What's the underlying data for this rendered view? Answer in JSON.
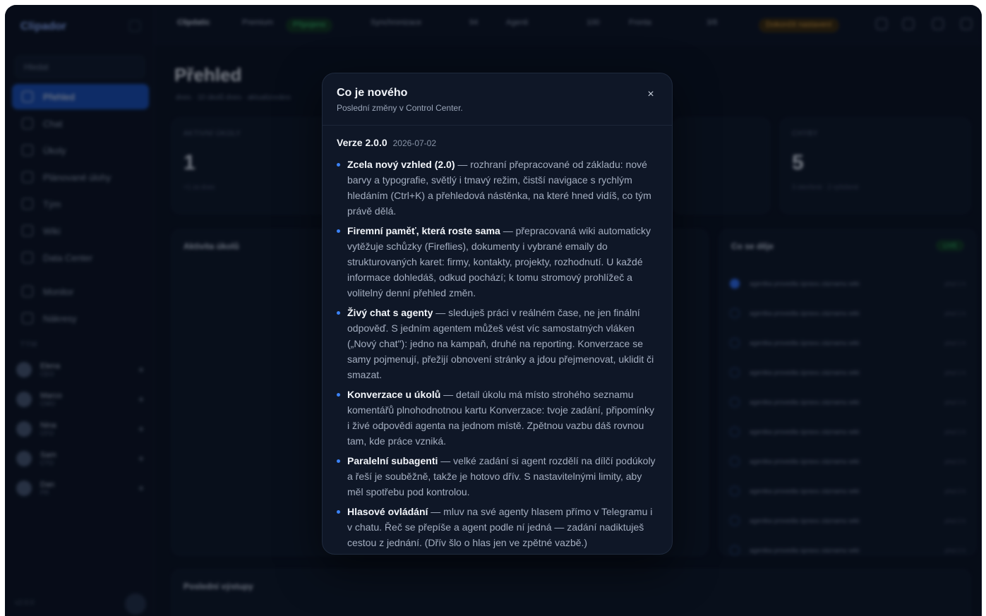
{
  "app": {
    "logo": "Clipador",
    "search_placeholder": "Hledat",
    "nav": [
      "Přehled",
      "Chat",
      "Úkoly",
      "Plánované úlohy",
      "Tým",
      "Wiki",
      "Data Center",
      "Monitor",
      "Nákresy"
    ],
    "team_header": "TÝM",
    "agents": [
      {
        "name": "Elena",
        "role": "CEO"
      },
      {
        "name": "Marco",
        "role": "CMO"
      },
      {
        "name": "Nina",
        "role": "CFO"
      },
      {
        "name": "Sam",
        "role": "CTO"
      },
      {
        "name": "Dan",
        "role": "PR"
      }
    ],
    "footer": "v2.0.0",
    "topbar": {
      "brand": "Clipdatic",
      "plan": "Premium",
      "status": "Připojeno",
      "synced_label": "Synchronizace",
      "synced_value": "94",
      "agents_label": "Agenti",
      "agents_value": "100",
      "queue_label": "Fronta",
      "queue_value": "3/8",
      "warning": "Dokončit nastavení"
    },
    "title": "Přehled",
    "crumbs": "dnes · 10 úkolů dnes · aktualizováno",
    "kpi1": {
      "label": "AKTIVNÍ ÚKOLY",
      "value": "1",
      "sub": "+1 za dnes"
    },
    "kpi2": {
      "label": "CHYBY",
      "value": "5",
      "sub": "3 otevřené · 2 vyřešené"
    },
    "activity_title": "Aktivita úkolů",
    "feed_title": "Co se děje",
    "feed_badge": "LIVE",
    "feed_items": [
      {
        "text": "agentka provedla úpravu záznamu wiki",
        "time": "před 1 h"
      },
      {
        "text": "agentka provedla úpravu záznamu wiki",
        "time": "před 1 h"
      },
      {
        "text": "agentka provedla úpravu záznamu wiki",
        "time": "před 1 h"
      },
      {
        "text": "agentka provedla úpravu záznamu wiki",
        "time": "před 1 h"
      },
      {
        "text": "agentka provedla úpravu záznamu wiki",
        "time": "před 1 h"
      },
      {
        "text": "agentka provedla úpravu záznamu wiki",
        "time": "před 1 h"
      },
      {
        "text": "agentka provedla úpravu záznamu wiki",
        "time": "před 2 h"
      },
      {
        "text": "agentka provedla úpravu záznamu wiki",
        "time": "před 2 h"
      },
      {
        "text": "agentka provedla úpravu záznamu wiki",
        "time": "před 2 h"
      },
      {
        "text": "agentka provedla úpravu záznamu wiki",
        "time": "před 2 h"
      }
    ],
    "recent_title": "Poslední výstupy"
  },
  "modal": {
    "title": "Co je nového",
    "subtitle": "Poslední změny v Control Center.",
    "close": "×",
    "version_label": "Verze 2.0.0",
    "version_date": "2026-07-02",
    "items": [
      {
        "title": "Zcela nový vzhled (2.0)",
        "text": " — rozhraní přepracované od základu: nové barvy a typografie, světlý i tmavý režim, čistší navigace s rychlým hledáním (Ctrl+K) a přehledová nástěnka, na které hned vidíš, co tým právě dělá."
      },
      {
        "title": "Firemní paměť, která roste sama",
        "text": " — přepracovaná wiki automaticky vytěžuje schůzky (Fireflies), dokumenty i vybrané emaily do strukturovaných karet: firmy, kontakty, projekty, rozhodnutí. U každé informace dohledáš, odkud pochází; k tomu stromový prohlížeč a volitelný denní přehled změn."
      },
      {
        "title": "Živý chat s agenty",
        "text": " — sleduješ práci v reálném čase, ne jen finální odpověď. S jedním agentem můžeš vést víc samostatných vláken („Nový chat\"): jedno na kampaň, druhé na reporting. Konverzace se samy pojmenují, přežijí obnovení stránky a jdou přejmenovat, uklidit či smazat."
      },
      {
        "title": "Konverzace u úkolů",
        "text": " — detail úkolu má místo strohého seznamu komentářů plnohodnotnou kartu Konverzace: tvoje zadání, připomínky i živé odpovědi agenta na jednom místě. Zpětnou vazbu dáš rovnou tam, kde práce vzniká."
      },
      {
        "title": "Paralelní subagenti",
        "text": " — velké zadání si agent rozdělí na dílčí podúkoly a řeší je souběžně, takže je hotovo dřív. S nastavitelnými limity, aby měl spotřebu pod kontrolou."
      },
      {
        "title": "Hlasové ovládání",
        "text": " — mluv na své agenty hlasem přímo v Telegramu i v chatu. Řeč se přepíše a agent podle ní jedná — zadání nadiktuješ cestou z jednání. (Dřív šlo o hlas jen ve zpětné vazbě.)"
      }
    ]
  },
  "colors": {
    "background": "#0b1220",
    "accent": "#3b82f6",
    "modal_bg": "#0f1727"
  }
}
